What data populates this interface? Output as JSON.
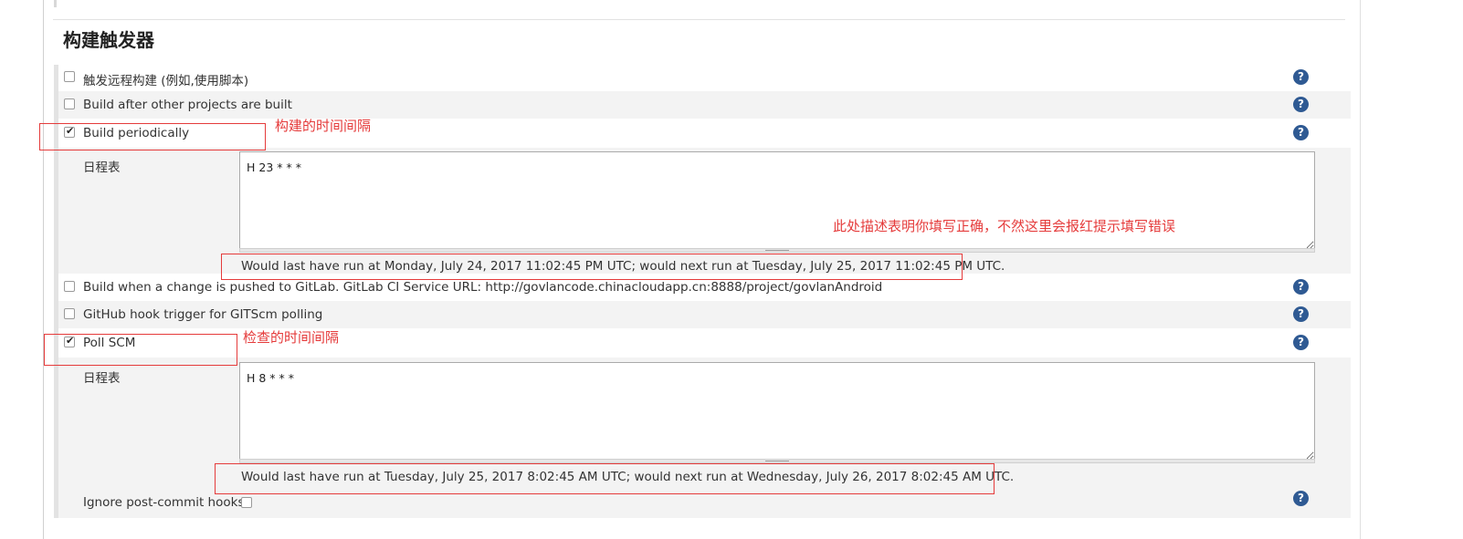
{
  "section": {
    "title": "构建触发器"
  },
  "triggers": [
    {
      "label": "触发远程构建 (例如,使用脚本)",
      "checked": false
    },
    {
      "label": "Build after other projects are built",
      "checked": false
    },
    {
      "label": "Build periodically",
      "checked": true
    },
    {
      "label": "Build when a change is pushed to GitLab. GitLab CI Service URL: http://govlancode.chinacloudapp.cn:8888/project/govlanAndroid",
      "checked": false
    },
    {
      "label": "GitHub hook trigger for GITScm polling",
      "checked": false
    },
    {
      "label": "Poll SCM",
      "checked": true
    }
  ],
  "periodic": {
    "schedule_label": "日程表",
    "schedule_value": "H 23 * * *",
    "validation": "Would last have run at Monday, July 24, 2017 11:02:45 PM UTC; would next run at Tuesday, July 25, 2017 11:02:45 PM UTC."
  },
  "poll": {
    "schedule_label": "日程表",
    "schedule_value": "H 8 * * *",
    "validation": "Would last have run at Tuesday, July 25, 2017 8:02:45 AM UTC; would next run at Wednesday, July 26, 2017 8:02:45 AM UTC.",
    "ignore_label": "Ignore post-commit hooks",
    "ignore_checked": false
  },
  "annotations": {
    "build_interval": "构建的时间间隔",
    "validation_note": "此处描述表明你填写正确，不然这里会报红提示填写错误",
    "poll_interval": "检查的时间间隔"
  },
  "icons": {
    "help": "help-icon",
    "help_glyph": "?",
    "check_glyph": "✔"
  },
  "colors": {
    "annotation_red": "#e53b3b",
    "help_blue": "#2f5a93",
    "zebra_gray": "#f3f3f3"
  }
}
